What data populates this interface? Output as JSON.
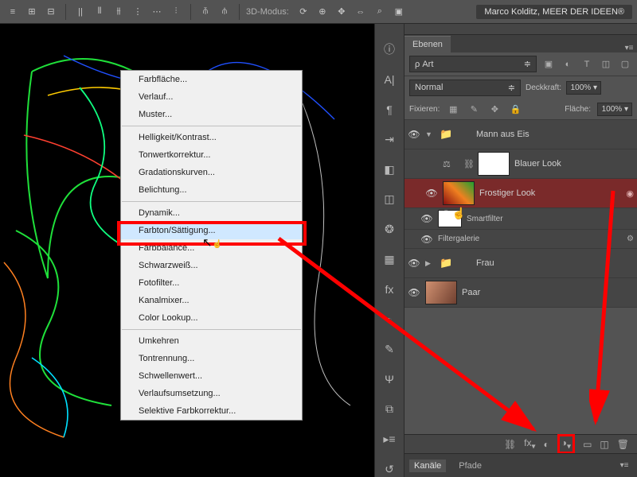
{
  "toolbar": {
    "mode3d_label": "3D-Modus:",
    "title_banner": "Marco Kolditz, MEER DER IDEEN®"
  },
  "context_menu": {
    "items": [
      {
        "label": "Farbfläche...",
        "sep_after": false
      },
      {
        "label": "Verlauf...",
        "sep_after": false
      },
      {
        "label": "Muster...",
        "sep_after": true
      },
      {
        "label": "Helligkeit/Kontrast...",
        "sep_after": false
      },
      {
        "label": "Tonwertkorrektur...",
        "sep_after": false
      },
      {
        "label": "Gradationskurven...",
        "sep_after": false
      },
      {
        "label": "Belichtung...",
        "sep_after": true
      },
      {
        "label": "Dynamik...",
        "sep_after": false
      },
      {
        "label": "Farbton/Sättigung...",
        "sep_after": false,
        "highlighted": true
      },
      {
        "label": "Farbbalance...",
        "sep_after": false
      },
      {
        "label": "Schwarzweiß...",
        "sep_after": false
      },
      {
        "label": "Fotofilter...",
        "sep_after": false
      },
      {
        "label": "Kanalmixer...",
        "sep_after": false
      },
      {
        "label": "Color Lookup...",
        "sep_after": true
      },
      {
        "label": "Umkehren",
        "sep_after": false
      },
      {
        "label": "Tontrennung...",
        "sep_after": false
      },
      {
        "label": "Schwellenwert...",
        "sep_after": false
      },
      {
        "label": "Verlaufsumsetzung...",
        "sep_after": false
      },
      {
        "label": "Selektive Farbkorrektur...",
        "sep_after": false
      }
    ]
  },
  "panel": {
    "tab_layers": "Ebenen",
    "filter_kind": "Art",
    "blend_mode": "Normal",
    "opacity_label": "Deckkraft:",
    "opacity_value": "100%",
    "fill_label": "Fläche:",
    "fill_value": "100%",
    "lock_label": "Fixieren:"
  },
  "layers": {
    "group1": "Mann aus Eis",
    "layer_blauer": "Blauer Look",
    "layer_frostig": "Frostiger Look",
    "smartfilter": "Smartfilter",
    "filtergalerie": "Filtergalerie",
    "group_frau": "Frau",
    "layer_paar": "Paar"
  },
  "bottom": {
    "kanale": "Kanäle",
    "pfade": "Pfade"
  }
}
